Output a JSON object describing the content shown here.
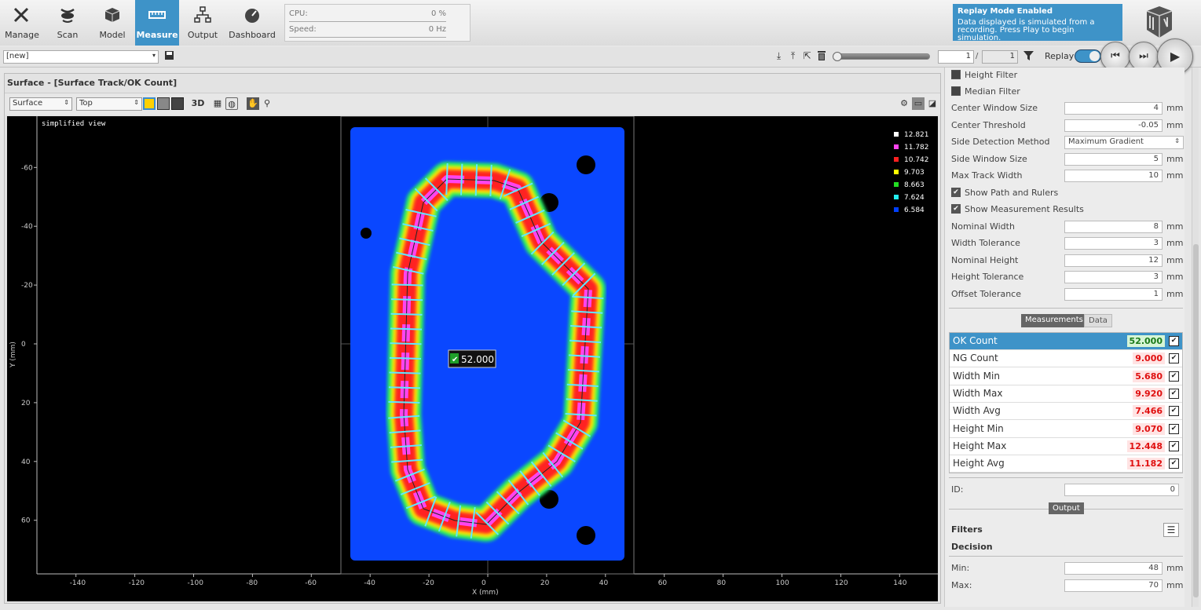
{
  "nav": {
    "items": [
      {
        "label": "Manage"
      },
      {
        "label": "Scan"
      },
      {
        "label": "Model"
      },
      {
        "label": "Measure"
      },
      {
        "label": "Output"
      },
      {
        "label": "Dashboard"
      }
    ],
    "active": "Measure"
  },
  "perf": {
    "cpu_label": "CPU:",
    "cpu_value": "0 %",
    "speed_label": "Speed:",
    "speed_value": "0 Hz"
  },
  "replay_notice": {
    "title": "Replay Mode Enabled",
    "message": "Data displayed is simulated from a recording. Press Play to begin simulation."
  },
  "toolbar": {
    "job_value": "[new]",
    "frame_current": "1",
    "frame_separator": "/",
    "frame_total": "1",
    "replay_label": "Replay"
  },
  "panel": {
    "title": "Surface - [Surface Track/OK Count]",
    "view_type": "Surface",
    "view_dir": "Top",
    "label_3d": "3D"
  },
  "plot": {
    "overlay_label": "simplified view",
    "ylabel": "Y (mm)",
    "xlabel": "X (mm)",
    "xticks": [
      "-140",
      "-120",
      "-100",
      "-80",
      "-60",
      "-40",
      "-20",
      "0",
      "20",
      "40",
      "60",
      "80",
      "100",
      "120",
      "140"
    ],
    "yticks": [
      "-60",
      "-40",
      "-20",
      "0",
      "20",
      "40",
      "60"
    ],
    "badge_value": "52.000",
    "legend": [
      {
        "value": "12.821",
        "color": "#ffffff"
      },
      {
        "value": "11.782",
        "color": "#ff44ee"
      },
      {
        "value": "10.742",
        "color": "#ff2020"
      },
      {
        "value": "9.703",
        "color": "#ffff00"
      },
      {
        "value": "8.663",
        "color": "#22dd22"
      },
      {
        "value": "7.624",
        "color": "#22eeee"
      },
      {
        "value": "6.584",
        "color": "#0040ff"
      }
    ]
  },
  "settings": {
    "height_filter": "Height Filter",
    "median_filter": "Median Filter",
    "rows": [
      {
        "label": "Center Window Size",
        "value": "4",
        "unit": "mm"
      },
      {
        "label": "Center Threshold",
        "value": "-0.05",
        "unit": "mm"
      },
      {
        "label": "Side Detection Method",
        "value": "Maximum Gradient",
        "unit": ""
      },
      {
        "label": "Side Window Size",
        "value": "5",
        "unit": "mm"
      },
      {
        "label": "Max Track Width",
        "value": "10",
        "unit": "mm"
      }
    ],
    "show_path": "Show Path and Rulers",
    "show_results": "Show Measurement Results",
    "rows2": [
      {
        "label": "Nominal Width",
        "value": "8",
        "unit": "mm"
      },
      {
        "label": "Width Tolerance",
        "value": "3",
        "unit": "mm"
      },
      {
        "label": "Nominal Height",
        "value": "12",
        "unit": "mm"
      },
      {
        "label": "Height Tolerance",
        "value": "3",
        "unit": "mm"
      },
      {
        "label": "Offset Tolerance",
        "value": "1",
        "unit": "mm"
      }
    ]
  },
  "tabs": {
    "measurements": "Measurements",
    "data": "Data"
  },
  "measurements": [
    {
      "name": "OK Count",
      "value": "52.000",
      "status": "ok"
    },
    {
      "name": "NG Count",
      "value": "9.000",
      "status": "ng"
    },
    {
      "name": "Width Min",
      "value": "5.680",
      "status": "ng"
    },
    {
      "name": "Width Max",
      "value": "9.920",
      "status": "ng"
    },
    {
      "name": "Width Avg",
      "value": "7.466",
      "status": "ng"
    },
    {
      "name": "Height Min",
      "value": "9.070",
      "status": "ng"
    },
    {
      "name": "Height Max",
      "value": "12.448",
      "status": "ng"
    },
    {
      "name": "Height Avg",
      "value": "11.182",
      "status": "ng"
    }
  ],
  "output": {
    "id_label": "ID:",
    "id_value": "0",
    "section_label": "Output",
    "filters_label": "Filters",
    "decision_label": "Decision",
    "min_label": "Min:",
    "min_value": "48",
    "max_label": "Max:",
    "max_value": "70",
    "unit": "mm"
  }
}
